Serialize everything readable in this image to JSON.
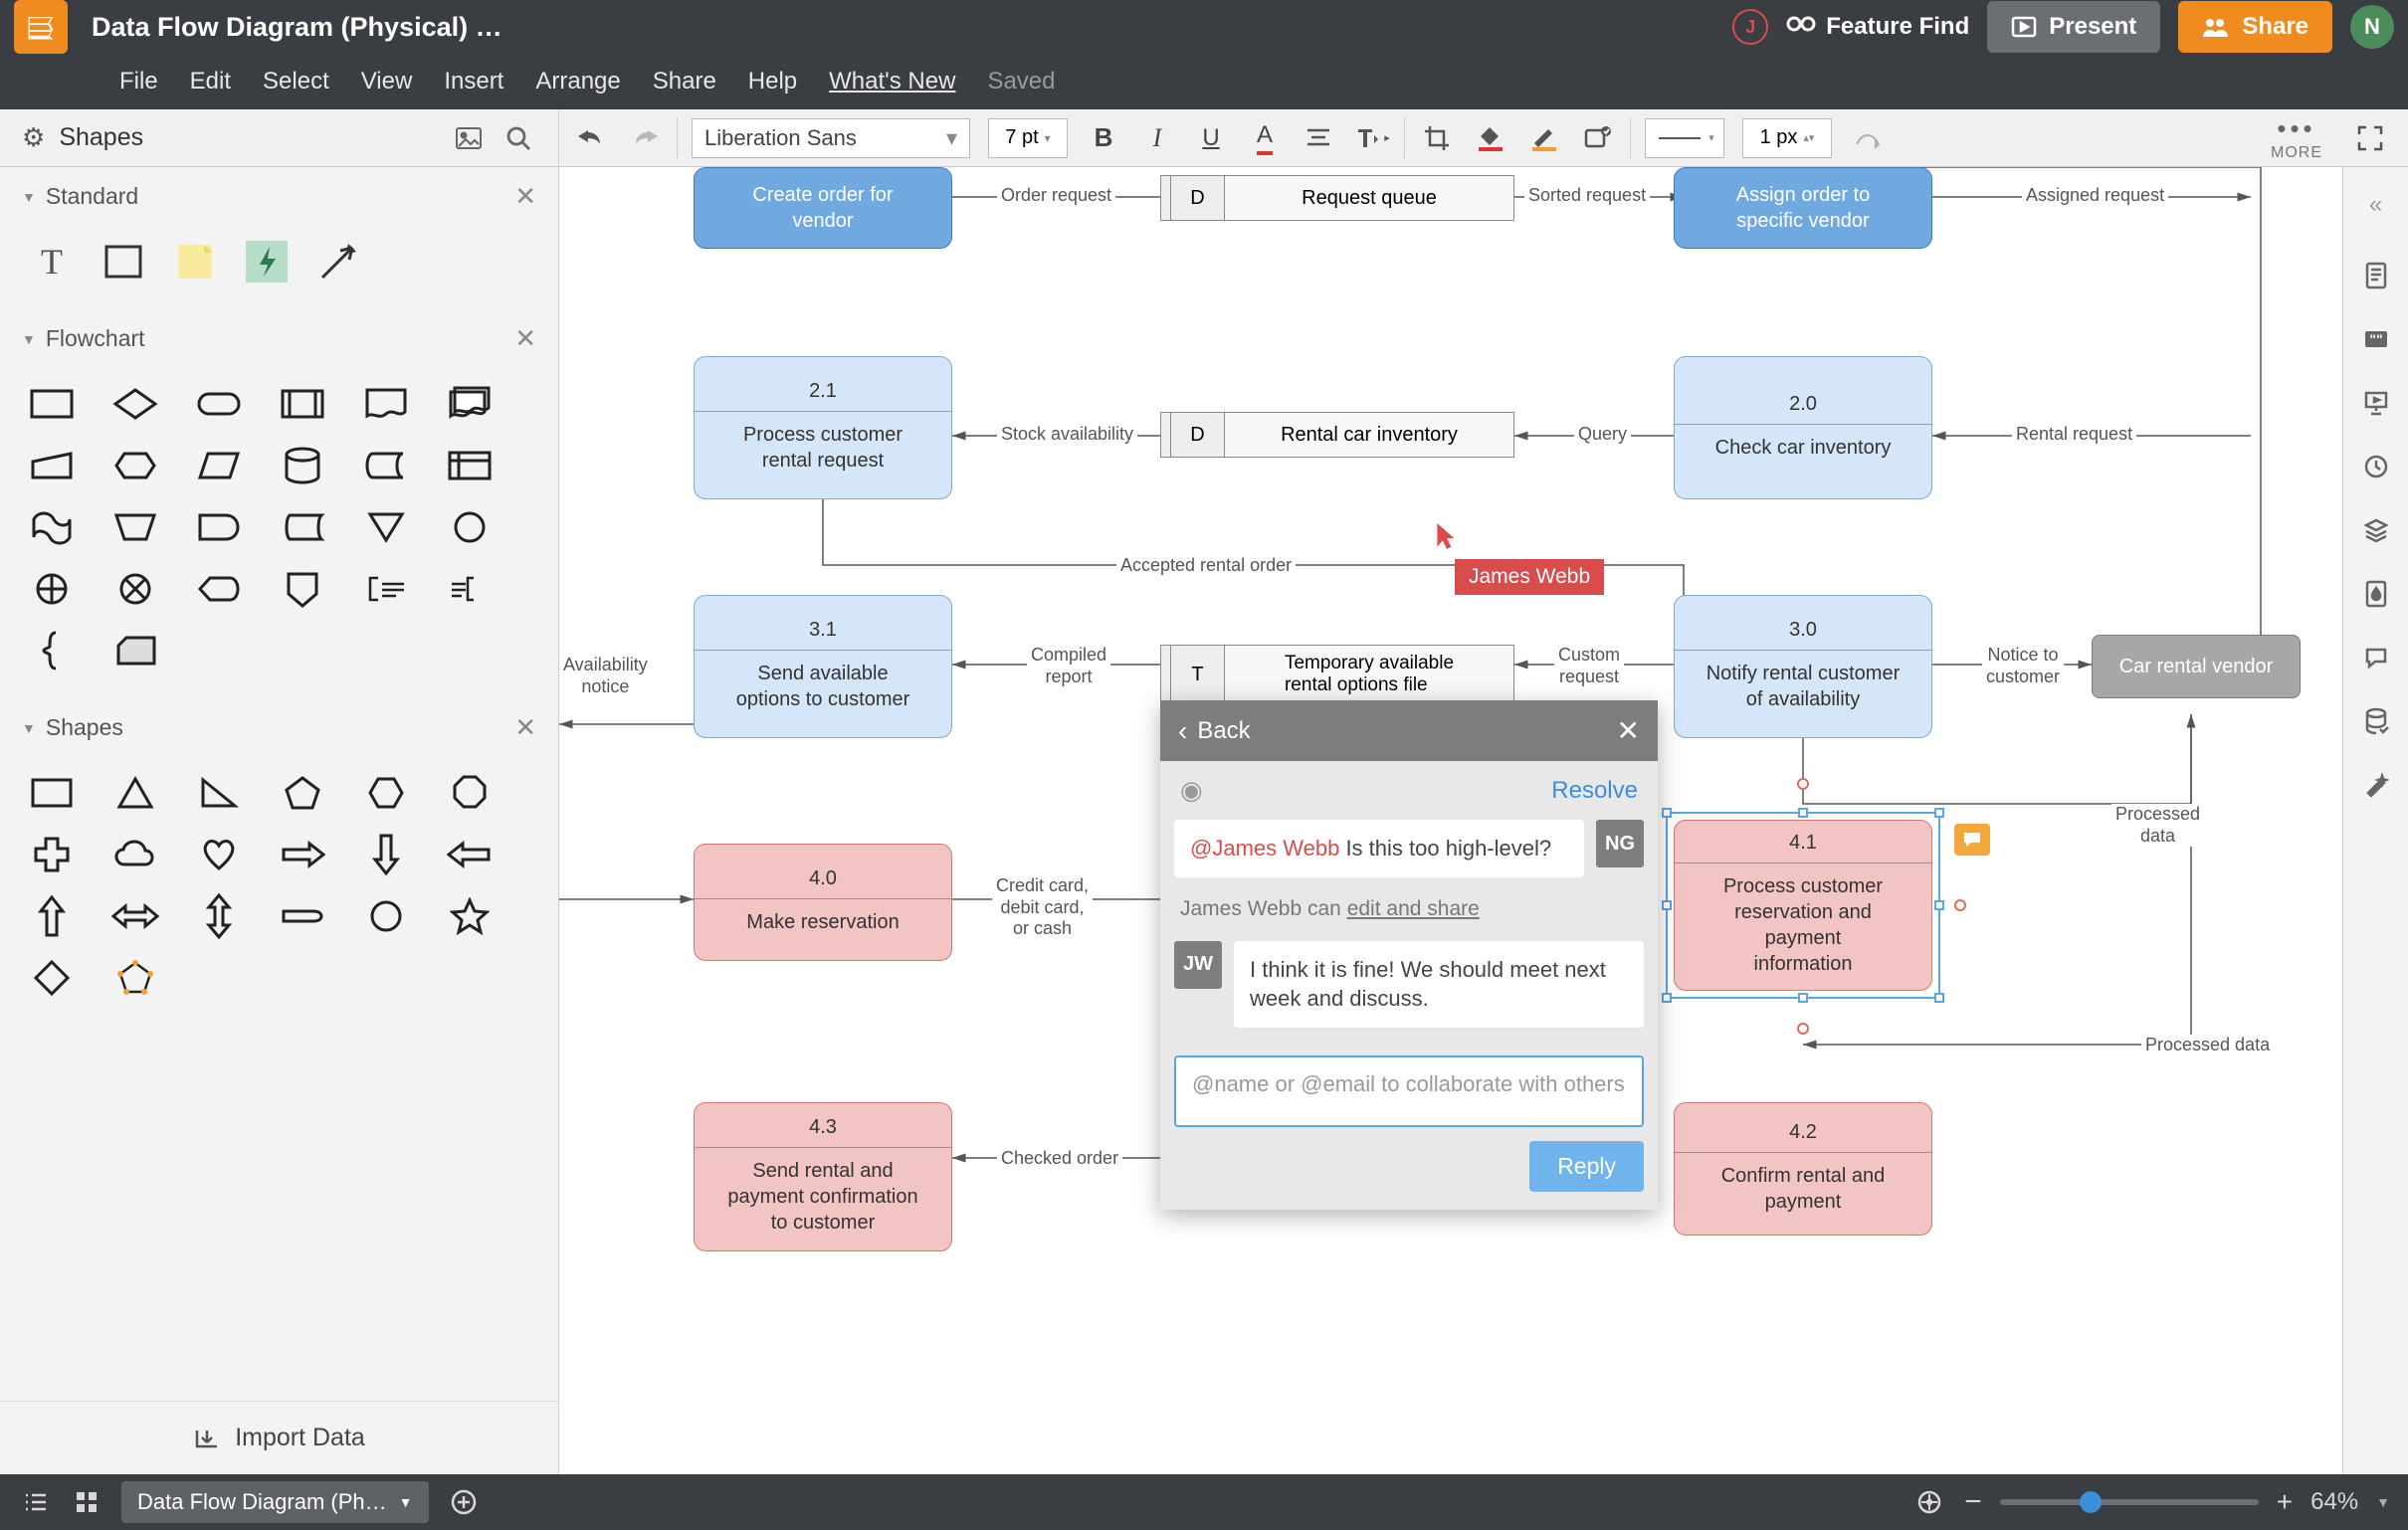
{
  "doc_title": "Data Flow Diagram (Physical) …",
  "menubar": [
    "File",
    "Edit",
    "Select",
    "View",
    "Insert",
    "Arrange",
    "Share",
    "Help",
    "What's New",
    "Saved"
  ],
  "header": {
    "feature_find": "Feature Find",
    "present": "Present",
    "share": "Share",
    "avatar_j": "J",
    "avatar_n": "N"
  },
  "toolbar": {
    "shapes_label": "Shapes",
    "font": "Liberation Sans",
    "pt": "7 pt",
    "line_width": "1 px",
    "more": "MORE"
  },
  "left_panel": {
    "sections": [
      "Standard",
      "Flowchart",
      "Shapes"
    ],
    "import_data": "Import Data"
  },
  "nodes": {
    "create_order": "Create order for\nvendor",
    "request_queue": "Request queue",
    "assign_order": "Assign order to\nspecific vendor",
    "p21_id": "2.1",
    "p21": "Process customer\nrental request",
    "rental_inv": "Rental car inventory",
    "p20_id": "2.0",
    "p20": "Check car inventory",
    "p31_id": "3.1",
    "p31": "Send available\noptions to customer",
    "temp_file": "Temporary available\nrental options file",
    "p30_id": "3.0",
    "p30": "Notify rental customer\nof availability",
    "p40_id": "4.0",
    "p40": "Make reservation",
    "p41_id": "4.1",
    "p41": "Process customer\nreservation and\npayment\ninformation",
    "p43_id": "4.3",
    "p43": "Send rental and\npayment confirmation\nto customer",
    "p42_id": "4.2",
    "p42": "Confirm rental and\npayment",
    "vendor": "Car rental vendor",
    "ds_d": "D",
    "ds_t": "T"
  },
  "edges": {
    "order_request": "Order request",
    "sorted_request": "Sorted request",
    "assigned_request": "Assigned request",
    "stock_avail": "Stock availability",
    "query": "Query",
    "rental_request": "Rental request",
    "accepted": "Accepted rental order",
    "compiled_report": "Compiled\nreport",
    "custom_request": "Custom\nrequest",
    "notice": "Notice to\ncustomer",
    "avail_notice": "Availability\nnotice",
    "credit": "Credit card,\ndebit card,\nor cash",
    "checked_order": "Checked order",
    "processed_data_r": "Processed\ndata",
    "processed_data_b": "Processed data"
  },
  "live_cursor": {
    "name": "James Webb"
  },
  "comment_panel": {
    "back": "Back",
    "resolve": "Resolve",
    "msg1_mention": "@James Webb",
    "msg1_text": " Is this too high-level?",
    "msg1_avatar": "NG",
    "perm_prefix": "James Webb can ",
    "perm_link": "edit and share",
    "msg2_avatar": "JW",
    "msg2_text": "I think it is fine! We should meet next week and discuss.",
    "input_placeholder": "@name or @email to collaborate with others",
    "reply": "Reply"
  },
  "bottom": {
    "page_tab": "Data Flow Diagram (Ph…",
    "zoom": "64%",
    "zoom_thumb_pct": 35
  }
}
